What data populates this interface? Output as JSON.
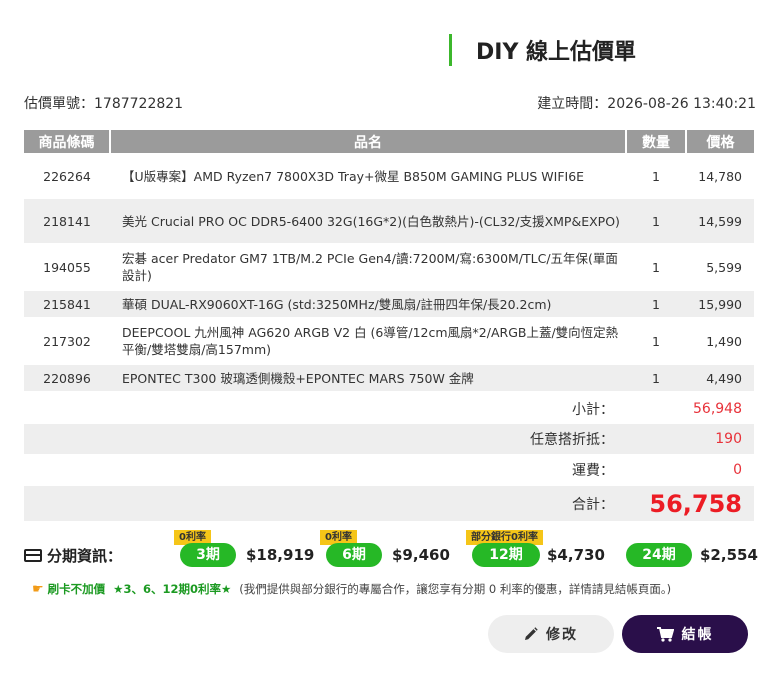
{
  "title": "DIY 線上估價單",
  "meta": {
    "quote_no": "估價單號：1787722821",
    "created": "建立時間：2026-08-26 13:40:21"
  },
  "table": {
    "headers": [
      "商品條碼",
      "品名",
      "數量",
      "價格"
    ],
    "rows": [
      {
        "code": "226264",
        "name": "【U版專案】AMD Ryzen7 7800X3D Tray+微星 B850M GAMING PLUS WIFI6E",
        "qty": "1",
        "price": "14,780"
      },
      {
        "code": "218141",
        "name": "美光 Crucial PRO OC DDR5-6400 32G(16G*2)(白色散熱片)-(CL32/支援XMP&EXPO)",
        "qty": "1",
        "price": "14,599"
      },
      {
        "code": "194055",
        "name": "宏碁 acer Predator GM7 1TB/M.2 PCIe Gen4/讀:7200M/寫:6300M/TLC/五年保(單面設計)",
        "qty": "1",
        "price": "5,599"
      },
      {
        "code": "215841",
        "name": "華碩 DUAL-RX9060XT-16G (std:3250MHz/雙風扇/註冊四年保/長20.2cm)",
        "qty": "1",
        "price": "15,990"
      },
      {
        "code": "217302",
        "name": "DEEPCOOL 九州風神 AG620 ARGB V2 白 (6導管/12cm風扇*2/ARGB上蓋/雙向恆定熱平衡/雙塔雙扇/高157mm)",
        "qty": "1",
        "price": "1,490"
      },
      {
        "code": "220896",
        "name": "EPONTEC T300 玻璃透側機殼+EPONTEC MARS 750W 金牌",
        "qty": "1",
        "price": "4,490"
      }
    ]
  },
  "summary": {
    "subtotal_label": "小計：",
    "subtotal": "56,948",
    "discount_label": "任意搭折抵：",
    "discount": "190",
    "shipping_label": "運費：",
    "shipping": "0",
    "total_label": "合計：",
    "total": "56,758"
  },
  "installment": {
    "label": "分期資訊：",
    "plans": [
      {
        "badge": "0利率",
        "term": "3期",
        "amount": "$18,919"
      },
      {
        "badge": "0利率",
        "term": "6期",
        "amount": "$9,460"
      },
      {
        "badge": "部分銀行0利率",
        "term": "12期",
        "amount": "$4,730"
      },
      {
        "badge": "",
        "term": "24期",
        "amount": "$2,554"
      }
    ]
  },
  "promo": {
    "card": "刷卡不加價",
    "highlight": "★3、6、12期0利率★",
    "text": "(我們提供與部分銀行的專屬合作，讓您享有分期 0 利率的優惠，詳情請見結帳頁面。)"
  },
  "buttons": {
    "edit": "修改",
    "checkout": "結帳"
  },
  "colors": {
    "accent_green": "#26b826",
    "price_red": "#ec1c24",
    "checkout_bg": "#2a0f4a",
    "badge_yellow": "#f5c518"
  }
}
